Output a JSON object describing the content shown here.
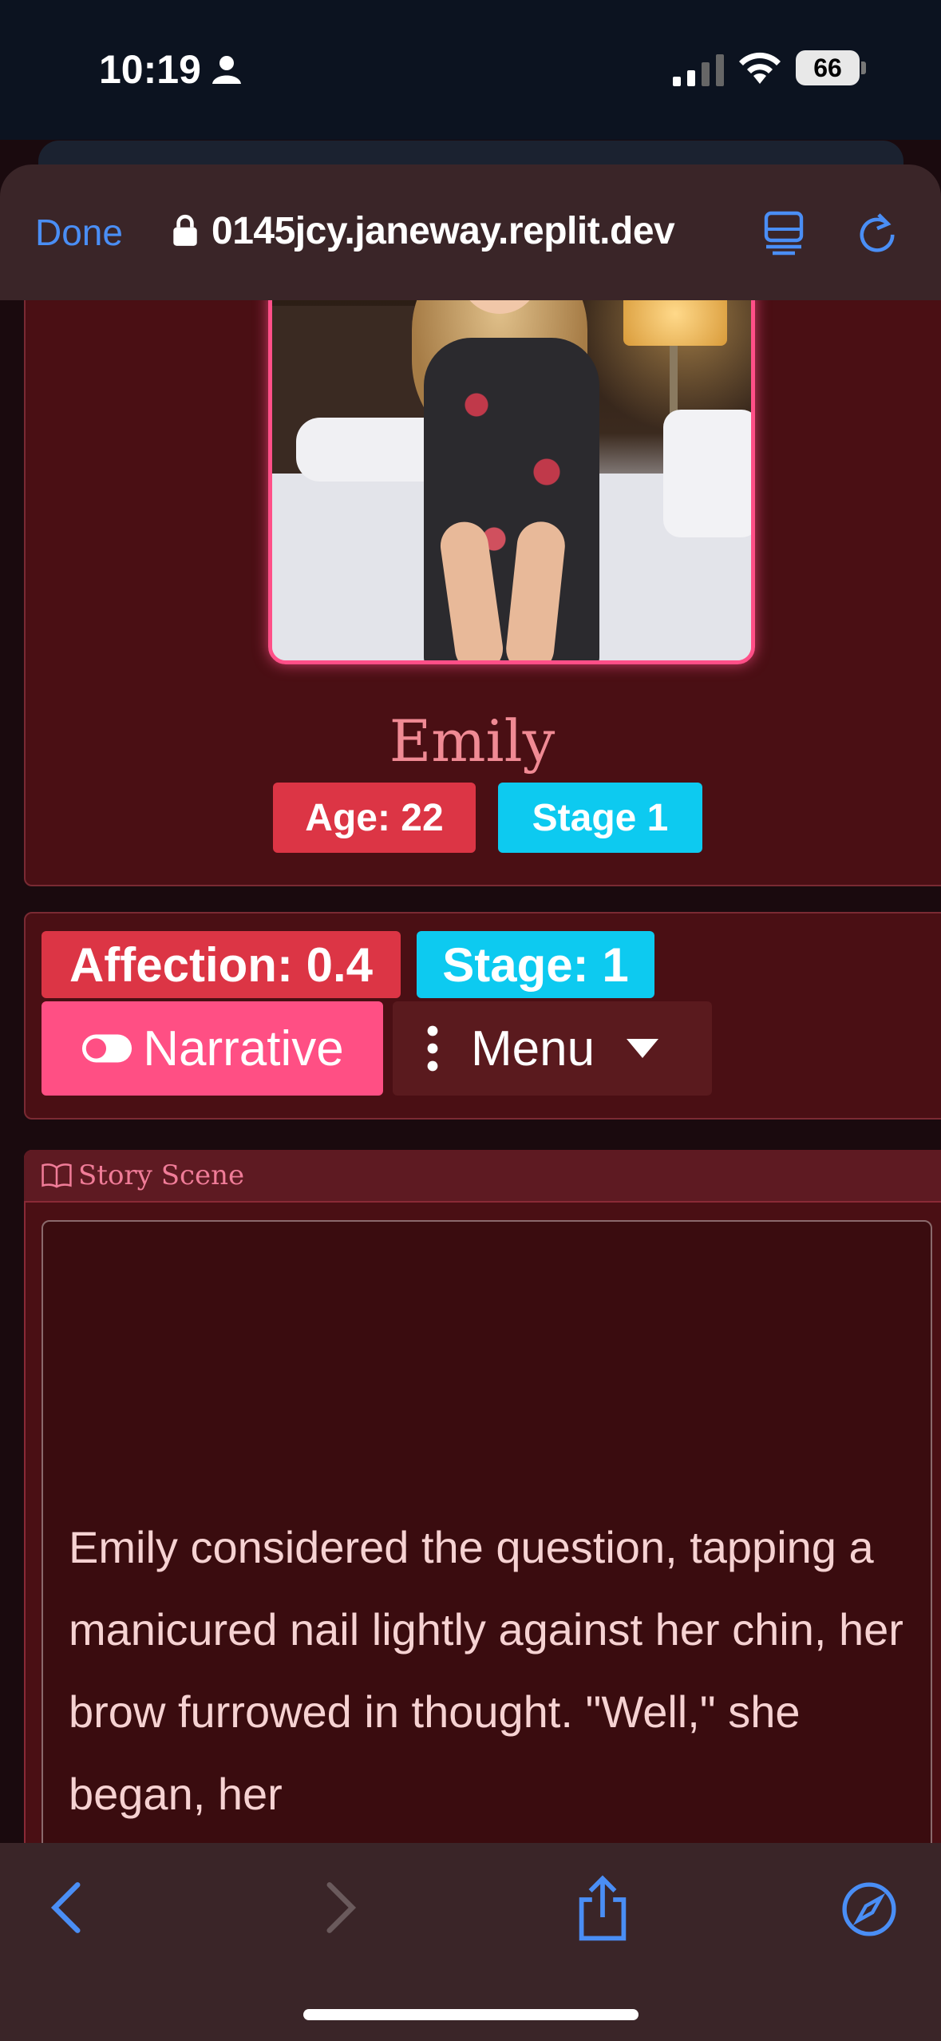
{
  "status_bar": {
    "time": "10:19",
    "battery": "66"
  },
  "browser": {
    "done_label": "Done",
    "url": "0145jcy.janeway.replit.dev"
  },
  "profile": {
    "name": "Emily",
    "age_badge": "Age: 22",
    "stage_badge": "Stage 1"
  },
  "controls": {
    "affection_badge": "Affection: 0.4",
    "stage_badge": "Stage: 1",
    "narrative_label": "Narrative",
    "menu_label": "Menu"
  },
  "story": {
    "header": "Story Scene",
    "text": "Emily considered the question, tapping a manicured nail lightly against her chin, her brow furrowed in thought. \"Well,\" she began, her"
  },
  "colors": {
    "accent_pink": "#ff4f84",
    "badge_red": "#dc3545",
    "badge_cyan": "#0dcaf0",
    "card_bg": "#4a0f14",
    "link_blue": "#4a8ef5"
  },
  "icons": [
    "person-icon",
    "signal-icon",
    "wifi-icon",
    "lock-icon",
    "reader-icon",
    "reload-icon",
    "toggle-icon",
    "kebab-icon",
    "caret-down-icon",
    "book-icon",
    "back-icon",
    "forward-icon",
    "share-icon",
    "compass-icon"
  ]
}
